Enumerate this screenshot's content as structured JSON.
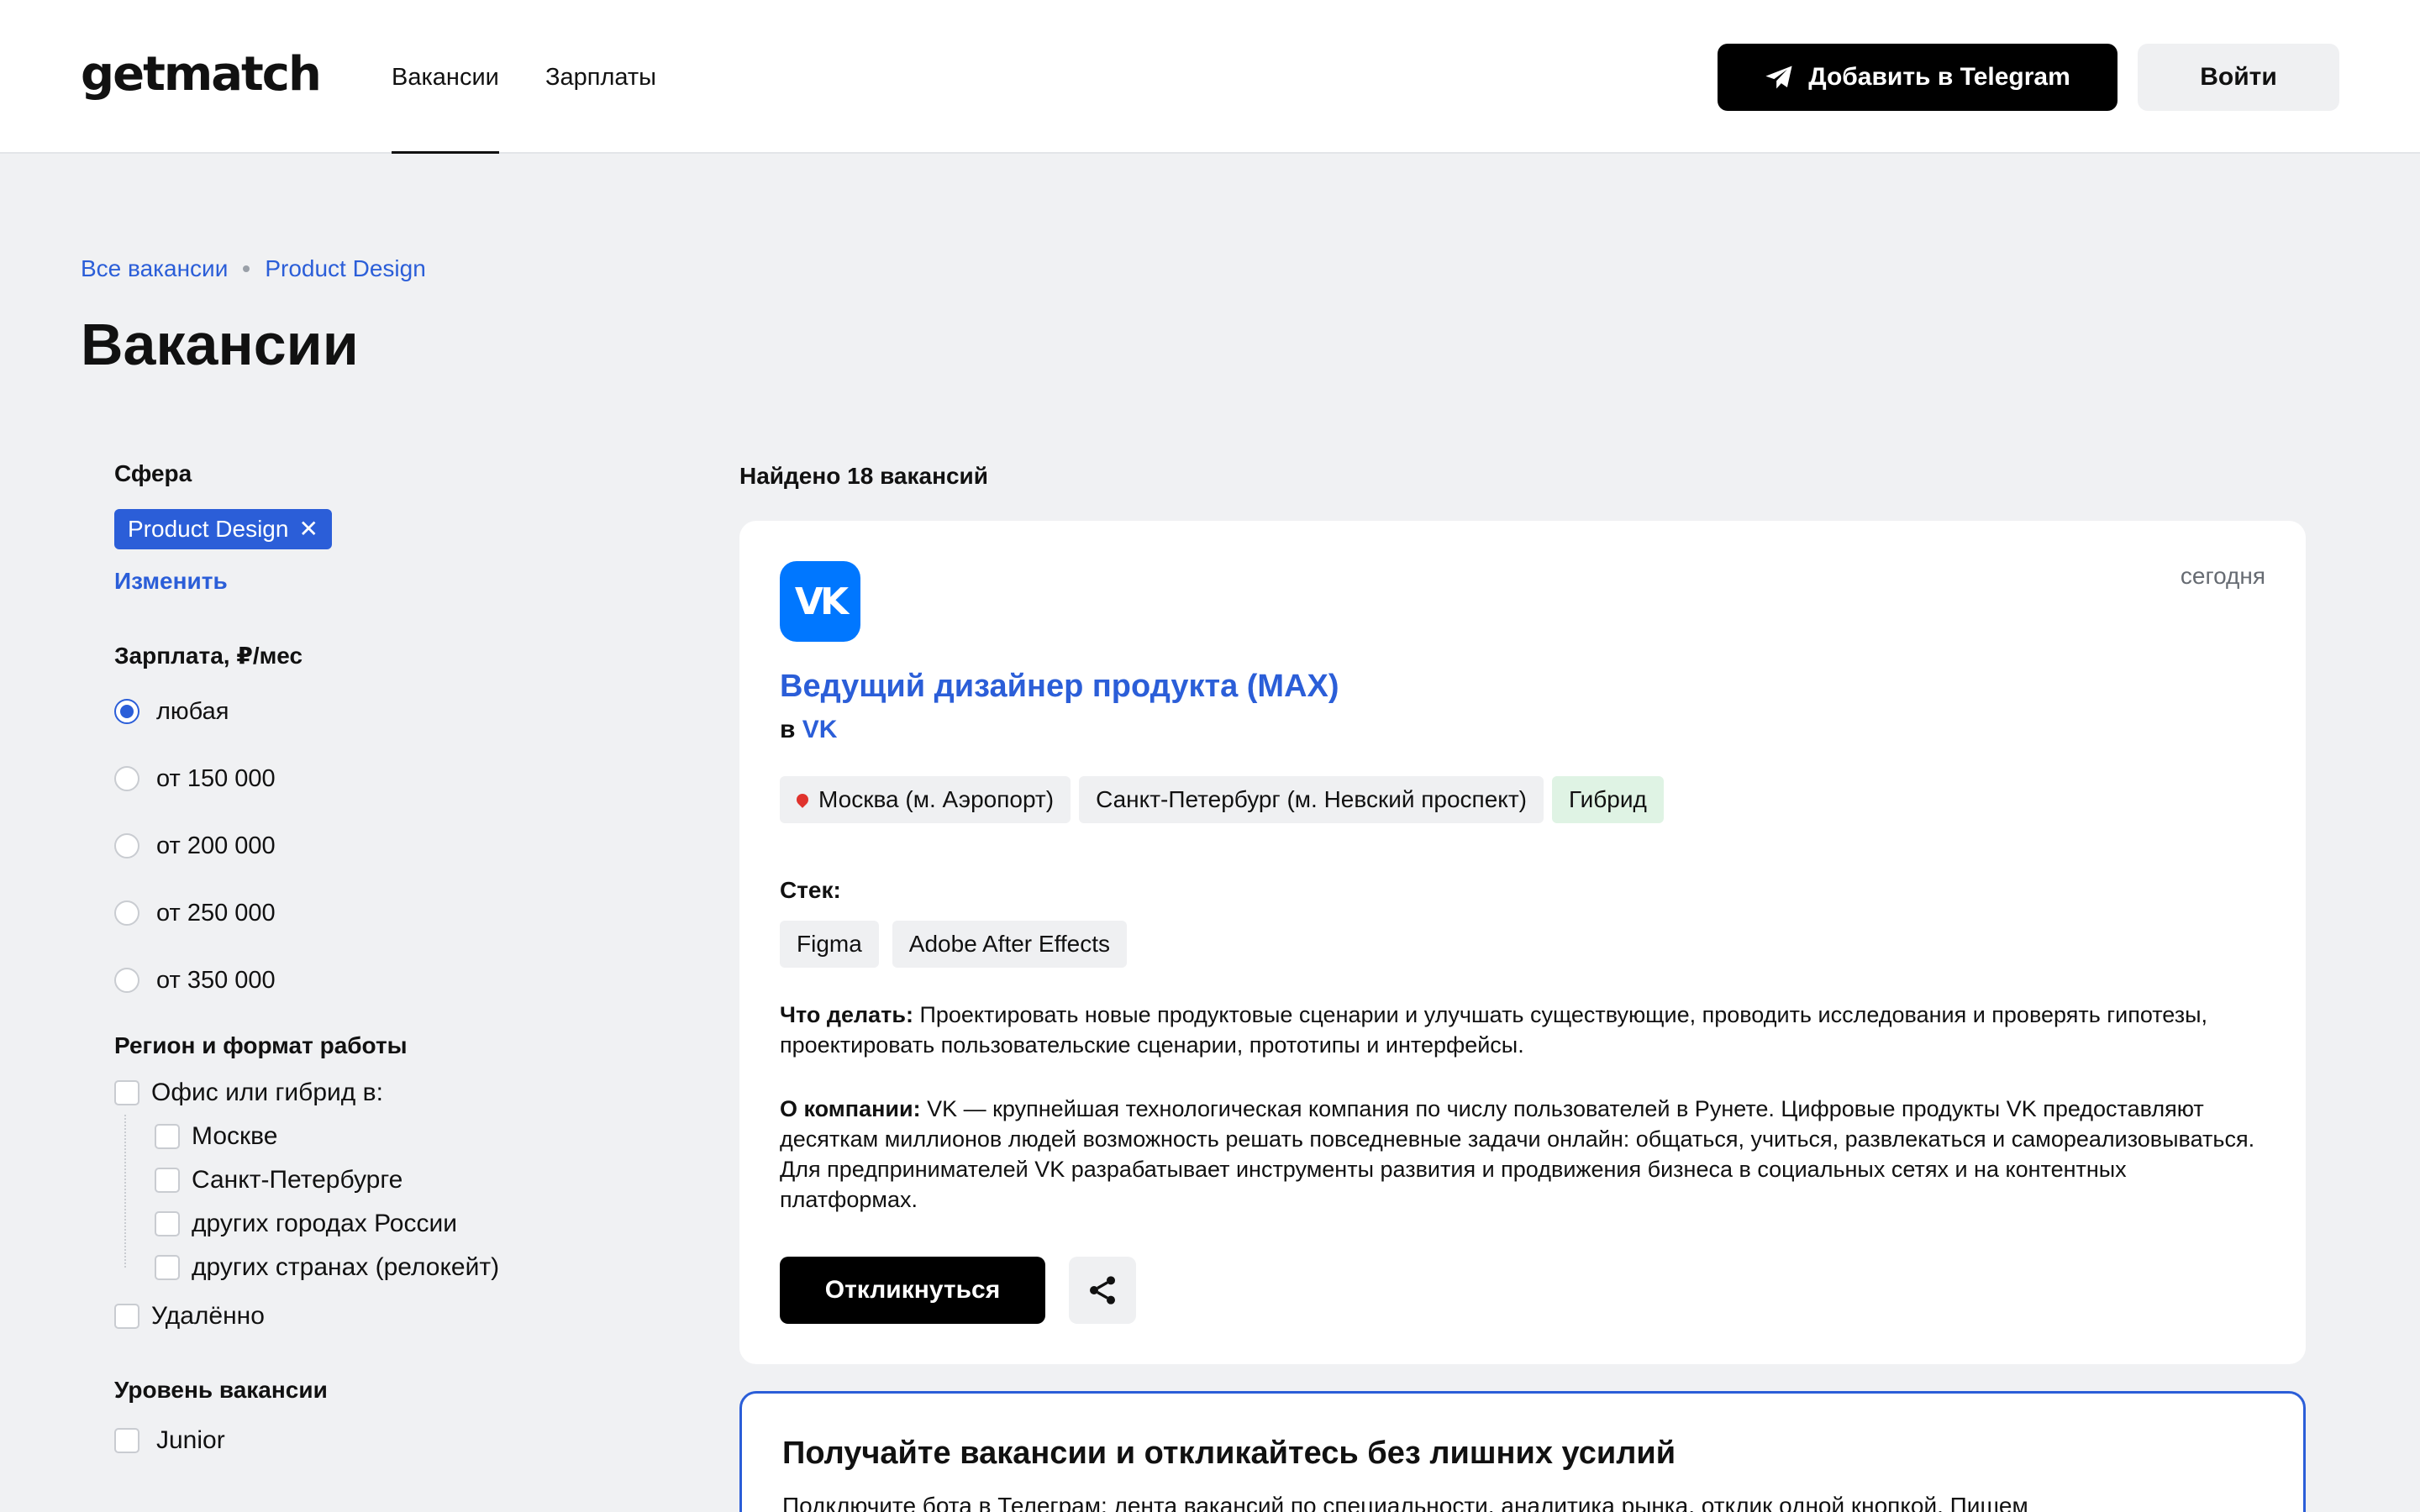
{
  "header": {
    "logo": "getmatch",
    "nav": [
      "Вакансии",
      "Зарплаты"
    ],
    "telegram_button": "Добавить в Telegram",
    "login_button": "Войти"
  },
  "breadcrumbs": [
    "Все вакансии",
    "Product Design"
  ],
  "page_title": "Вакансии",
  "sidebar": {
    "sphere": {
      "title": "Сфера",
      "selected_chip": "Product Design",
      "change_link": "Изменить"
    },
    "salary": {
      "title": "Зарплата, ₽/мес",
      "options": [
        "любая",
        "от 150 000",
        "от 200 000",
        "от 250 000",
        "от 350 000"
      ],
      "selected": "любая"
    },
    "region": {
      "title": "Регион и формат работы",
      "office_label": "Офис или гибрид в:",
      "cities": [
        "Москве",
        "Санкт-Петербурге",
        "других городах России",
        "других странах (релокейт)"
      ],
      "remote_label": "Удалённо"
    },
    "level": {
      "title": "Уровень вакансии",
      "options": [
        "Junior"
      ]
    }
  },
  "main": {
    "found_text": "Найдено 18 вакансий",
    "vacancy": {
      "logo_text": "VK",
      "date": "сегодня",
      "title": "Ведущий дизайнер продукта (MAX)",
      "company_prefix": "в",
      "company": "VK",
      "locations": [
        "Москва (м. Аэропорт)",
        "Санкт-Петербург (м. Невский проспект)"
      ],
      "format": "Гибрид",
      "stack_label": "Стек:",
      "stack": [
        "Figma",
        "Adobe After Effects"
      ],
      "todo_label": "Что делать:",
      "todo_text": " Проектировать новые продуктовые сценарии и улучшать существующие, проводить исследования и проверять гипотезы, проектировать пользовательские сценарии, прототипы и интерфейсы.",
      "about_label": "О компании:",
      "about_text": " VK — крупнейшая технологическая компания по числу пользователей в Рунете. Цифровые продукты VK предоставляют десяткам миллионов людей возможность решать повседневные задачи онлайн: общаться, учиться, развлекаться и самореализовываться. Для предпринимателей VK разрабатывает инструменты развития и продвижения бизнеса в социальных сетях и на контентных платформах.",
      "apply_button": "Откликнуться"
    },
    "promo": {
      "title": "Получайте вакансии и откликайтесь без лишних усилий",
      "text": "Подключите бота в Телеграм: лента вакансий по специальности, аналитика рынка, отклик одной кнопкой. Пишем"
    }
  },
  "colors": {
    "accent": "#2b5ed8",
    "vk_blue": "#0077ff",
    "background": "#f0f1f3"
  }
}
